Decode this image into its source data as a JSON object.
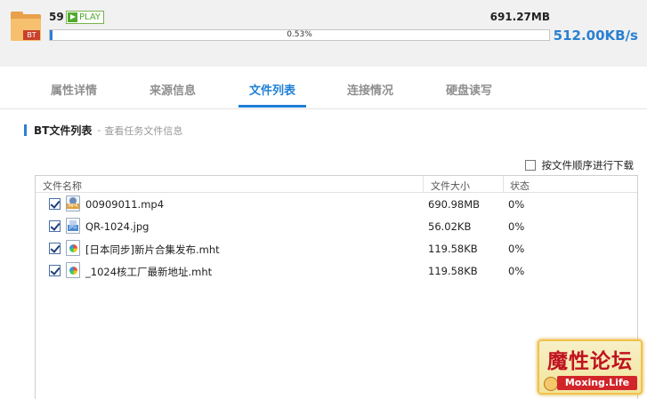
{
  "task": {
    "folder_badge": "BT",
    "count": "59",
    "play_label": "PLAY",
    "total_size": "691.27MB",
    "progress_percent": 0.53,
    "progress_text": "0.53%",
    "speed": "512.00KB/s"
  },
  "tabs": [
    {
      "label": "属性详情",
      "active": false
    },
    {
      "label": "来源信息",
      "active": false
    },
    {
      "label": "文件列表",
      "active": true
    },
    {
      "label": "连接情况",
      "active": false
    },
    {
      "label": "硬盘读写",
      "active": false
    }
  ],
  "section": {
    "title": "BT文件列表",
    "separator": "-",
    "subtitle": "查看任务文件信息",
    "sequential_label": "按文件顺序进行下载"
  },
  "table": {
    "headers": [
      "文件名称",
      "文件大小",
      "状态"
    ],
    "rows": [
      {
        "name": "00909011.mp4",
        "size": "690.98MB",
        "status": "0%",
        "icon": "mp4-file-icon",
        "checked": true
      },
      {
        "name": "QR-1024.jpg",
        "size": "56.02KB",
        "status": "0%",
        "icon": "jpg-file-icon",
        "checked": true
      },
      {
        "name": "[日本同步]新片合集发布.mht",
        "size": "119.58KB",
        "status": "0%",
        "icon": "mht-file-icon",
        "checked": true
      },
      {
        "name": "_1024核工厂最新地址.mht",
        "size": "119.58KB",
        "status": "0%",
        "icon": "mht-file-icon",
        "checked": true
      }
    ]
  },
  "watermark": {
    "title": "魔性论坛",
    "site": "Moxing.Life"
  },
  "colors": {
    "accent": "#1e7fd6",
    "progress": "#2a7fd6",
    "play_green": "#4faa2e"
  }
}
